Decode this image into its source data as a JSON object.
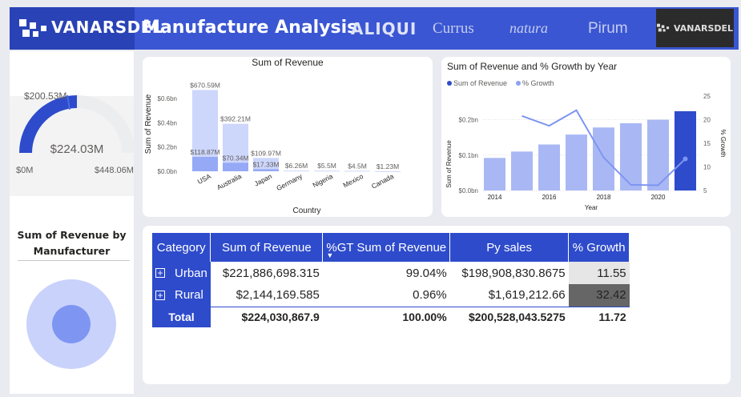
{
  "header": {
    "brand": "VANARSDEL",
    "title": "Manufacture Analysis",
    "logos": [
      "ALIQUI",
      "Currus",
      "natura",
      "Pirum"
    ],
    "active_logo": "VANARSDEL",
    "colors": {
      "header_bg": "#3a56d2",
      "brand_bg": "#2942b5",
      "accent": "#2e4bcb"
    }
  },
  "gauge": {
    "value_label": "$224.03M",
    "target_label": "$200.53M",
    "min_label": "$0M",
    "max_label": "$448.06M",
    "value": 224.03,
    "target": 200.53,
    "min": 0,
    "max": 448.06
  },
  "manufacturer": {
    "title": "Sum of Revenue by Manufacturer"
  },
  "country_chart": {
    "title": "Sum of Revenue",
    "xlabel": "Country",
    "ylabel": "Sum of Revenue",
    "yticks": [
      "$0.0bn",
      "$0.2bn",
      "$0.4bn",
      "$0.6bn"
    ],
    "chart_data": {
      "type": "bar",
      "categories": [
        "USA",
        "Australia",
        "Japan",
        "Germany",
        "Nigeria",
        "Mexico",
        "Canada"
      ],
      "ylim": [
        0,
        0.72
      ],
      "series": [
        {
          "values": [
            0.67059,
            0.39221,
            0.10997,
            0.00626,
            0.0055,
            0.0045,
            0.00123
          ],
          "labels": [
            "$670.59M",
            "$392.21M",
            "$109.97M",
            "$6.26M",
            "$5.5M",
            "$4.5M",
            "$1.23M"
          ]
        },
        {
          "values": [
            0.11887,
            0.07034,
            0.01733
          ],
          "labels": [
            "$118.87M",
            "$70.34M",
            "$17.33M"
          ]
        }
      ]
    }
  },
  "year_chart": {
    "title": "Sum of Revenue and % Growth by Year",
    "legend": [
      "Sum of Revenue",
      "% Growth"
    ],
    "xlabel": "Year",
    "ylabel": "Sum of Revenue",
    "y2label": "% Growth",
    "yticks": [
      "$0.0bn",
      "$0.1bn",
      "$0.2bn"
    ],
    "y2ticks": [
      "5",
      "10",
      "15",
      "20",
      "25"
    ],
    "xticks": [
      "2014",
      "2016",
      "2018",
      "2020"
    ],
    "chart_data": {
      "type": "bar",
      "x": [
        2014,
        2015,
        2016,
        2017,
        2018,
        2019,
        2020,
        2021
      ],
      "ylim": [
        0,
        0.26
      ],
      "y2lim": [
        5,
        25
      ],
      "series": [
        {
          "name": "Sum of Revenue",
          "values": [
            0.092,
            0.11,
            0.13,
            0.158,
            0.178,
            0.19,
            0.2,
            0.224
          ]
        },
        {
          "name": "% Growth",
          "type": "line",
          "x": [
            2015,
            2016,
            2017,
            2018,
            2019,
            2020,
            2021
          ],
          "values": [
            20.8,
            18.7,
            22.0,
            12.0,
            6.2,
            6.1,
            11.7
          ]
        }
      ]
    }
  },
  "matrix": {
    "headers": [
      "Category",
      "Sum of Revenue",
      "%GT Sum of Revenue",
      "Py sales",
      "% Growth"
    ],
    "rows": [
      {
        "category": "Urban",
        "revenue": "$221,886,698.315",
        "gt": "99.04%",
        "py": "$198,908,830.8675",
        "growth": "11.55"
      },
      {
        "category": "Rural",
        "revenue": "$2,144,169.585",
        "gt": "0.96%",
        "py": "$1,619,212.66",
        "growth": "32.42"
      }
    ],
    "total": {
      "label": "Total",
      "revenue": "$224,030,867.9",
      "gt": "100.00%",
      "py": "$200,528,043.5275",
      "growth": "11.72"
    }
  }
}
